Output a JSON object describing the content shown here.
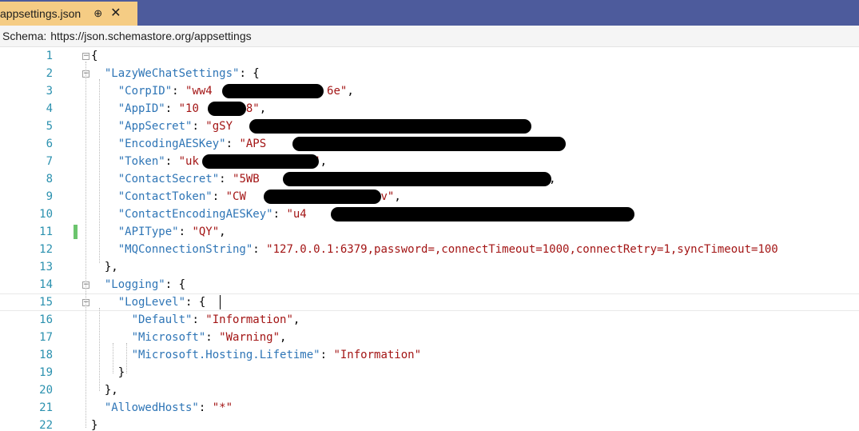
{
  "tab": {
    "title": "appsettings.json",
    "pin": "⊕",
    "close": "✕"
  },
  "schema": {
    "label": "Schema:",
    "url": "https://json.schemastore.org/appsettings"
  },
  "lines": [
    {
      "n": "1",
      "parts": [
        [
          "p",
          "{"
        ]
      ]
    },
    {
      "n": "2",
      "parts": [
        [
          "p",
          "  "
        ],
        [
          "k",
          "\"LazyWeChatSettings\""
        ],
        [
          "p",
          ": {"
        ]
      ]
    },
    {
      "n": "3",
      "parts": [
        [
          "p",
          "    "
        ],
        [
          "k",
          "\"CorpID\""
        ],
        [
          "p",
          ": "
        ],
        [
          "s",
          "\"ww4                 6e\""
        ],
        [
          "p",
          ","
        ]
      ]
    },
    {
      "n": "4",
      "parts": [
        [
          "p",
          "    "
        ],
        [
          "k",
          "\"AppID\""
        ],
        [
          "p",
          ": "
        ],
        [
          "s",
          "\"10       8\""
        ],
        [
          "p",
          ","
        ]
      ]
    },
    {
      "n": "5",
      "parts": [
        [
          "p",
          "    "
        ],
        [
          "k",
          "\"AppSecret\""
        ],
        [
          "p",
          ": "
        ],
        [
          "s",
          "\"gSY                                       EVk\""
        ],
        [
          "p",
          ","
        ]
      ]
    },
    {
      "n": "6",
      "parts": [
        [
          "p",
          "    "
        ],
        [
          "k",
          "\"EncodingAESKey\""
        ],
        [
          "p",
          ": "
        ],
        [
          "s",
          "\"APS                                       k3r\""
        ],
        [
          "p",
          ","
        ]
      ]
    },
    {
      "n": "7",
      "parts": [
        [
          "p",
          "    "
        ],
        [
          "k",
          "\"Token\""
        ],
        [
          "p",
          ": "
        ],
        [
          "s",
          "\"uk              e6v\""
        ],
        [
          "p",
          ","
        ]
      ]
    },
    {
      "n": "8",
      "parts": [
        [
          "p",
          "    "
        ],
        [
          "k",
          "\"ContactSecret\""
        ],
        [
          "p",
          ": "
        ],
        [
          "s",
          "\"5WB                                      hOIc\""
        ],
        [
          "p",
          ","
        ]
      ]
    },
    {
      "n": "9",
      "parts": [
        [
          "p",
          "    "
        ],
        [
          "k",
          "\"ContactToken\""
        ],
        [
          "p",
          ": "
        ],
        [
          "s",
          "\"CW                  eLv\""
        ],
        [
          "p",
          ","
        ]
      ]
    },
    {
      "n": "10",
      "parts": [
        [
          "p",
          "    "
        ],
        [
          "k",
          "\"ContactEncodingAESKey\""
        ],
        [
          "p",
          ": "
        ],
        [
          "s",
          "\"u4                                          MV\""
        ],
        [
          "p",
          ","
        ]
      ]
    },
    {
      "n": "11",
      "parts": [
        [
          "p",
          "    "
        ],
        [
          "k",
          "\"APIType\""
        ],
        [
          "p",
          ": "
        ],
        [
          "s",
          "\"QY\""
        ],
        [
          "p",
          ","
        ]
      ]
    },
    {
      "n": "12",
      "parts": [
        [
          "p",
          "    "
        ],
        [
          "k",
          "\"MQConnectionString\""
        ],
        [
          "p",
          ": "
        ],
        [
          "s",
          "\"127.0.0.1:6379,password=,connectTimeout=1000,connectRetry=1,syncTimeout=100"
        ]
      ]
    },
    {
      "n": "13",
      "parts": [
        [
          "p",
          "  },"
        ]
      ]
    },
    {
      "n": "14",
      "parts": [
        [
          "p",
          "  "
        ],
        [
          "k",
          "\"Logging\""
        ],
        [
          "p",
          ": {"
        ]
      ]
    },
    {
      "n": "15",
      "parts": [
        [
          "p",
          "    "
        ],
        [
          "k",
          "\"LogLevel\""
        ],
        [
          "p",
          ": {"
        ]
      ]
    },
    {
      "n": "16",
      "parts": [
        [
          "p",
          "      "
        ],
        [
          "k",
          "\"Default\""
        ],
        [
          "p",
          ": "
        ],
        [
          "s",
          "\"Information\""
        ],
        [
          "p",
          ","
        ]
      ]
    },
    {
      "n": "17",
      "parts": [
        [
          "p",
          "      "
        ],
        [
          "k",
          "\"Microsoft\""
        ],
        [
          "p",
          ": "
        ],
        [
          "s",
          "\"Warning\""
        ],
        [
          "p",
          ","
        ]
      ]
    },
    {
      "n": "18",
      "parts": [
        [
          "p",
          "      "
        ],
        [
          "k",
          "\"Microsoft.Hosting.Lifetime\""
        ],
        [
          "p",
          ": "
        ],
        [
          "s",
          "\"Information\""
        ]
      ]
    },
    {
      "n": "19",
      "parts": [
        [
          "p",
          "    }"
        ]
      ]
    },
    {
      "n": "20",
      "parts": [
        [
          "p",
          "  },"
        ]
      ]
    },
    {
      "n": "21",
      "parts": [
        [
          "p",
          "  "
        ],
        [
          "k",
          "\"AllowedHosts\""
        ],
        [
          "p",
          ": "
        ],
        [
          "s",
          "\"*\""
        ]
      ]
    },
    {
      "n": "22",
      "parts": [
        [
          "p",
          "}"
        ]
      ]
    }
  ],
  "colors": {
    "tab_bg": "#f5cc84",
    "titlebar": "#4d5b9c",
    "key": "#2e75b6",
    "string": "#a31515",
    "line_number": "#2b91af"
  }
}
